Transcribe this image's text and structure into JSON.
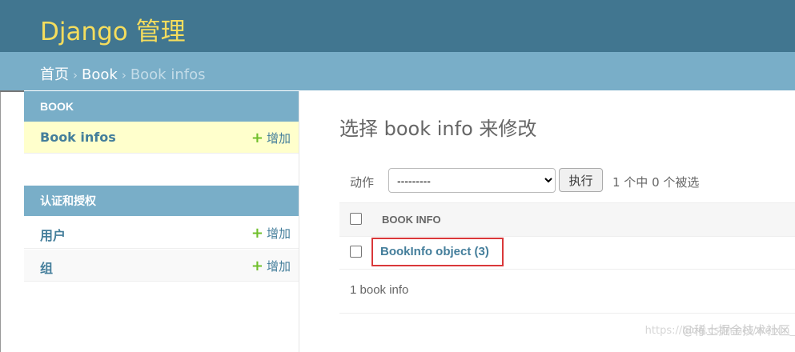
{
  "header": {
    "brand": "Django 管理"
  },
  "breadcrumbs": {
    "home": "首页",
    "app": "Book",
    "current": "Book infos",
    "separator": "›"
  },
  "sidebar": {
    "modules": [
      {
        "caption": "BOOK",
        "rows": [
          {
            "label": "Book infos",
            "add": "增加",
            "selected": true
          }
        ]
      },
      {
        "caption": "认证和授权",
        "rows": [
          {
            "label": "用户",
            "add": "增加"
          },
          {
            "label": "组",
            "add": "增加"
          }
        ]
      }
    ],
    "add_icon": "plus-icon"
  },
  "content": {
    "title": "选择 book info 来修改",
    "actions": {
      "label": "动作",
      "select_value": "---------",
      "go": "执行",
      "counter": "1 个中 0 个被选"
    },
    "table": {
      "column": "BOOK INFO",
      "rows": [
        {
          "label": "BookInfo object (3)"
        }
      ]
    },
    "paginator": "1 book info"
  },
  "watermark": {
    "text": "@稀土掘金技术社区",
    "url_text": "https://blog.csdn.net/weixin_"
  },
  "colors": {
    "header": "#417690",
    "breadcrumbs": "#79aec8",
    "brand": "#f5dd5d",
    "link": "#447e9b",
    "add": "#70bf2b",
    "highlight": "#d9383a"
  }
}
